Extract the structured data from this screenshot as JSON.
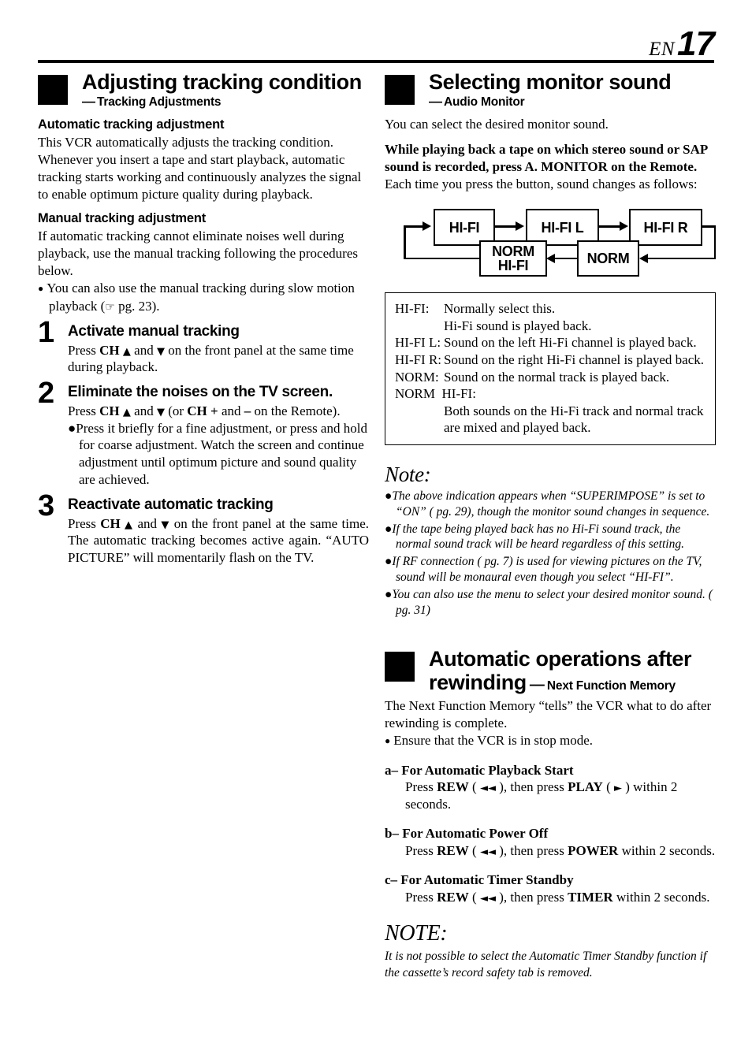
{
  "header": {
    "lang_code": "EN",
    "page_number": "17"
  },
  "left_column": {
    "section": {
      "title": "Adjusting tracking condition",
      "subtitle": "Tracking Adjustments",
      "dash": "—"
    },
    "auto_heading": "Automatic tracking adjustment",
    "auto_body": "This VCR automatically adjusts the tracking condition. Whenever you insert a tape and start playback, automatic tracking starts working and continuously analyzes the signal to enable optimum picture quality during playback.",
    "manual_heading": "Manual tracking adjustment",
    "manual_body": "If automatic tracking cannot eliminate noises well during playback, use the manual tracking following the procedures below.",
    "manual_bullet_pre": "You can also use the manual tracking during slow motion playback (",
    "manual_bullet_ref": "pg. 23",
    "manual_bullet_post": ").",
    "steps": [
      {
        "number": "1",
        "title": "Activate manual tracking",
        "body_pre": "Press ",
        "body_ch": "CH",
        "body_mid": " and ",
        "body_post": " on the front panel at the same time during playback."
      },
      {
        "number": "2",
        "title": "Eliminate the noises on the TV screen.",
        "body_pre": "Press ",
        "body_ch": "CH",
        "body_mid": " and ",
        "body_post": " (or ",
        "body_ch2": "CH +",
        "body_post2": " and ",
        "body_minus": "–",
        "body_post3": " on the Remote).",
        "bullet": "Press it briefly for a fine adjustment, or press and hold for coarse adjustment. Watch the screen and continue adjustment until optimum picture and sound quality are achieved."
      },
      {
        "number": "3",
        "title": "Reactivate automatic tracking",
        "body_pre": "Press ",
        "body_ch": "CH",
        "body_mid": " and ",
        "body_post": " on the front panel at the same time. The automatic tracking becomes active again. “AUTO PICTURE” will momentarily flash on the TV."
      }
    ]
  },
  "right_column": {
    "section_audio": {
      "title": "Selecting monitor sound",
      "subtitle": "Audio Monitor",
      "dash": "—"
    },
    "intro": "You can select the desired monitor sound.",
    "bold_lead": "While playing back a tape on which stereo sound or SAP sound is recorded, press A. MONITOR on the Remote.",
    "after_lead": "Each time you press the button, sound changes as follows:",
    "flow": {
      "boxes": [
        {
          "id": "hifi",
          "label": "HI-FI"
        },
        {
          "id": "hifi-l",
          "label": "HI-FI L"
        },
        {
          "id": "hifi-r",
          "label": "HI-FI R"
        },
        {
          "id": "norm",
          "label": "NORM"
        },
        {
          "id": "norm-hifi",
          "label": "NORM\nHI-FI"
        }
      ]
    },
    "legend": [
      {
        "label": "HI-FI:",
        "text": "Normally select this."
      },
      {
        "label": "",
        "text": "Hi-Fi sound is played back."
      },
      {
        "label": "HI-FI L:",
        "text": "Sound on the left Hi-Fi channel is played back."
      },
      {
        "label": "HI-FI R:",
        "text": "Sound on the right Hi-Fi channel is played back."
      },
      {
        "label": "NORM:",
        "text": "Sound on the normal track is played back."
      },
      {
        "label": "NORM  HI-FI:",
        "text": ""
      },
      {
        "label": "",
        "text": "Both sounds on the Hi-Fi track and normal track are mixed and played back."
      }
    ],
    "note_title": "Note:",
    "notes": [
      "The above indication appears when “SUPERIMPOSE” is set to “ON” ( pg. 29), though the monitor sound changes in sequence.",
      "If the tape being played back has no Hi-Fi sound track, the normal sound track will be heard regardless of this setting.",
      "If RF connection ( pg. 7) is used for viewing pictures on the TV, sound will be monaural even though you select “HI-FI”.",
      "You can also use the menu to select your desired monitor sound. ( pg. 31)"
    ],
    "section_rewind": {
      "title": "Automatic operations after rewinding",
      "subtitle": "Next Function Memory",
      "dash": "—"
    },
    "rewind_body": "The Next Function Memory “tells” the VCR what to do after rewinding is complete.",
    "rewind_bullet": "Ensure that the VCR is in stop mode.",
    "lettered_items": [
      {
        "head": "a–  For Automatic Playback Start",
        "pre": "Press ",
        "key1": "REW",
        "sym1": "◄◄",
        "mid": ", then press ",
        "key2": "PLAY",
        "sym2": "►",
        "post": " within 2 seconds."
      },
      {
        "head": "b–  For Automatic Power Off",
        "pre": "Press ",
        "key1": "REW",
        "sym1": "◄◄",
        "mid": ", then press ",
        "key2": "POWER",
        "sym2": "",
        "post": " within 2 seconds."
      },
      {
        "head": "c–  For Automatic Timer Standby",
        "pre": "Press ",
        "key1": "REW",
        "sym1": "◄◄",
        "mid": ", then press ",
        "key2": "TIMER",
        "sym2": "",
        "post": " within 2 seconds."
      }
    ],
    "final_note_title": "NOTE:",
    "final_note_text": "It is not possible to select the Automatic Timer Standby function if the cassette’s record safety tab is removed."
  },
  "symbols": {
    "hand": "☞",
    "bullet_dot": "●",
    "up_triangle": "▲",
    "down_triangle": "▼"
  }
}
